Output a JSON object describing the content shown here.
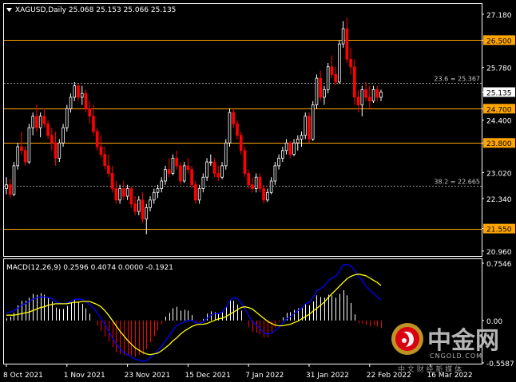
{
  "colors": {
    "background": "#000000",
    "frame": "#ffffff",
    "bull_candle": "#ffffff",
    "bear_candle": "#ff0000",
    "level_line": "#ffa500",
    "level_label_bg": "#ffa500",
    "fib_line": "#8c8c8c",
    "current_price_bg": "#ffffff",
    "macd_hist_pos": "#ffffff",
    "macd_hist_neg": "#ff0000",
    "macd_line": "#0000ff",
    "signal_line": "#ffff00",
    "watermark_red": "#e60012",
    "watermark_gold": "#c89b28"
  },
  "header": {
    "symbol_line": "XAGUSD,Daily  25.068 25.153 25.066 25.135",
    "arrow_icon": "triangle-down-icon"
  },
  "macd_header": "MACD(12,26,9) 0.2596 0.4074 0.0000 -0.1921",
  "current_price_label": "25.135",
  "fib_labels": [
    "23.6 = 25.367",
    "38.2 = 22.665"
  ],
  "watermark": {
    "cn": "中金网",
    "en": "CNGOLD.COM",
    "sub": "中 文 财 经 新 媒 体"
  },
  "chart_data": [
    {
      "type": "candlestick",
      "title": "XAGUSD,Daily",
      "ohlc_header": [
        25.068,
        25.153,
        25.066,
        25.135
      ],
      "ylim": [
        20.83,
        27.45
      ],
      "y_ticks": [
        "27.180",
        "26.500",
        "25.780",
        "25.135",
        "24.700",
        "24.400",
        "23.800",
        "23.020",
        "22.340",
        "21.550",
        "20.960"
      ],
      "x_tick_labels": [
        "8 Oct 2021",
        "1 Nov 2021",
        "23 Nov 2021",
        "15 Dec 2021",
        "7 Jan 2022",
        "31 Jan 2022",
        "22 Feb 2022",
        "16 Mar 2022"
      ],
      "x_tick_positions": [
        0,
        16,
        32,
        48,
        64,
        80,
        96,
        112
      ],
      "horizontal_levels": [
        26.5,
        24.7,
        23.8,
        21.55
      ],
      "fib_levels": [
        {
          "label": "23.6 = 25.367",
          "value": 25.367
        },
        {
          "label": "38.2 = 22.665",
          "value": 22.665
        }
      ],
      "current_price": 25.135,
      "ohlc": [
        [
          22.6,
          22.9,
          22.45,
          22.7
        ],
        [
          22.7,
          22.85,
          22.35,
          22.45
        ],
        [
          22.45,
          23.3,
          22.4,
          23.2
        ],
        [
          23.2,
          23.8,
          23.1,
          23.7
        ],
        [
          23.7,
          24.1,
          23.5,
          23.6
        ],
        [
          23.6,
          23.7,
          23.2,
          23.3
        ],
        [
          23.3,
          24.3,
          23.25,
          24.2
        ],
        [
          24.2,
          24.6,
          24.0,
          24.5
        ],
        [
          24.5,
          24.8,
          24.1,
          24.2
        ],
        [
          24.2,
          24.6,
          23.95,
          24.5
        ],
        [
          24.5,
          24.7,
          24.2,
          24.3
        ],
        [
          24.3,
          24.4,
          23.9,
          24.0
        ],
        [
          24.0,
          24.2,
          23.6,
          23.8
        ],
        [
          23.8,
          24.1,
          23.2,
          23.4
        ],
        [
          23.4,
          23.9,
          23.3,
          23.8
        ],
        [
          23.8,
          24.3,
          23.7,
          24.2
        ],
        [
          24.2,
          24.8,
          24.1,
          24.7
        ],
        [
          24.7,
          25.1,
          24.6,
          25.0
        ],
        [
          25.0,
          25.4,
          24.9,
          25.3
        ],
        [
          25.3,
          25.35,
          24.9,
          25.0
        ],
        [
          25.0,
          25.3,
          24.8,
          25.1
        ],
        [
          25.1,
          25.2,
          24.6,
          24.7
        ],
        [
          24.7,
          24.9,
          24.3,
          24.5
        ],
        [
          24.5,
          24.8,
          24.0,
          24.1
        ],
        [
          24.1,
          24.2,
          23.6,
          23.7
        ],
        [
          23.7,
          24.0,
          23.4,
          23.5
        ],
        [
          23.5,
          23.7,
          23.1,
          23.2
        ],
        [
          23.2,
          23.5,
          22.9,
          23.0
        ],
        [
          23.0,
          23.2,
          22.5,
          22.6
        ],
        [
          22.6,
          22.8,
          22.2,
          22.3
        ],
        [
          22.3,
          22.7,
          22.2,
          22.6
        ],
        [
          22.6,
          22.8,
          22.3,
          22.4
        ],
        [
          22.4,
          22.7,
          22.3,
          22.6
        ],
        [
          22.6,
          22.65,
          22.1,
          22.2
        ],
        [
          22.2,
          22.4,
          21.9,
          22.0
        ],
        [
          22.0,
          22.4,
          21.9,
          22.3
        ],
        [
          22.3,
          22.5,
          21.7,
          21.8
        ],
        [
          21.8,
          22.2,
          21.4,
          22.1
        ],
        [
          22.1,
          22.4,
          22.0,
          22.3
        ],
        [
          22.3,
          22.6,
          22.2,
          22.5
        ],
        [
          22.5,
          22.7,
          22.35,
          22.6
        ],
        [
          22.6,
          22.9,
          22.5,
          22.8
        ],
        [
          22.8,
          23.2,
          22.7,
          23.1
        ],
        [
          23.1,
          23.4,
          22.9,
          23.0
        ],
        [
          23.0,
          23.5,
          22.95,
          23.4
        ],
        [
          23.4,
          23.6,
          23.1,
          23.2
        ],
        [
          23.2,
          23.3,
          22.7,
          22.8
        ],
        [
          22.8,
          23.3,
          22.75,
          23.2
        ],
        [
          23.2,
          23.4,
          23.0,
          23.1
        ],
        [
          23.1,
          23.2,
          22.6,
          22.7
        ],
        [
          22.7,
          22.8,
          22.2,
          22.3
        ],
        [
          22.3,
          22.7,
          22.2,
          22.6
        ],
        [
          22.6,
          23.0,
          22.5,
          22.9
        ],
        [
          22.9,
          23.4,
          22.8,
          23.3
        ],
        [
          23.3,
          23.5,
          23.2,
          23.3
        ],
        [
          23.3,
          23.4,
          22.9,
          23.0
        ],
        [
          23.0,
          23.2,
          22.8,
          22.9
        ],
        [
          22.9,
          23.3,
          22.85,
          23.2
        ],
        [
          23.2,
          23.9,
          23.1,
          23.8
        ],
        [
          23.8,
          24.7,
          23.7,
          24.6
        ],
        [
          24.6,
          24.7,
          24.2,
          24.3
        ],
        [
          24.3,
          24.4,
          23.9,
          24.0
        ],
        [
          24.0,
          24.1,
          23.5,
          23.6
        ],
        [
          23.6,
          23.7,
          22.9,
          23.0
        ],
        [
          23.0,
          23.1,
          22.6,
          22.7
        ],
        [
          22.7,
          22.9,
          22.5,
          22.6
        ],
        [
          22.6,
          23.0,
          22.5,
          22.9
        ],
        [
          22.9,
          23.0,
          22.5,
          22.6
        ],
        [
          22.6,
          22.7,
          22.2,
          22.3
        ],
        [
          22.3,
          22.6,
          22.25,
          22.5
        ],
        [
          22.5,
          22.9,
          22.45,
          22.8
        ],
        [
          22.8,
          23.3,
          22.7,
          23.2
        ],
        [
          23.2,
          23.5,
          23.1,
          23.4
        ],
        [
          23.4,
          23.7,
          23.3,
          23.6
        ],
        [
          23.6,
          23.9,
          23.5,
          23.8
        ],
        [
          23.8,
          23.85,
          23.4,
          23.5
        ],
        [
          23.5,
          23.9,
          23.45,
          23.8
        ],
        [
          23.8,
          24.0,
          23.6,
          23.9
        ],
        [
          23.9,
          24.1,
          23.7,
          24.0
        ],
        [
          24.0,
          24.6,
          23.9,
          24.5
        ],
        [
          24.5,
          24.6,
          23.8,
          23.9
        ],
        [
          23.9,
          24.9,
          23.85,
          24.8
        ],
        [
          24.8,
          25.6,
          24.7,
          25.5
        ],
        [
          25.5,
          25.7,
          24.9,
          25.0
        ],
        [
          25.0,
          25.3,
          24.8,
          25.2
        ],
        [
          25.2,
          25.9,
          25.1,
          25.8
        ],
        [
          25.8,
          26.1,
          25.5,
          25.6
        ],
        [
          25.6,
          25.8,
          25.3,
          25.4
        ],
        [
          25.4,
          26.5,
          25.35,
          26.4
        ],
        [
          26.4,
          27.0,
          26.3,
          26.8
        ],
        [
          26.8,
          27.1,
          25.9,
          26.0
        ],
        [
          26.0,
          26.3,
          25.6,
          25.8
        ],
        [
          25.8,
          26.0,
          24.8,
          25.0
        ],
        [
          25.0,
          25.2,
          24.6,
          24.8
        ],
        [
          24.8,
          25.3,
          24.5,
          25.2
        ],
        [
          25.2,
          25.4,
          24.9,
          25.0
        ],
        [
          25.0,
          25.3,
          24.7,
          24.9
        ],
        [
          24.9,
          25.3,
          24.85,
          25.2
        ],
        [
          25.2,
          25.3,
          24.9,
          25.0
        ],
        [
          25.0,
          25.2,
          24.9,
          25.135
        ]
      ]
    },
    {
      "type": "line+bar",
      "title": "MACD(12,26,9)",
      "series_header": [
        0.2596,
        0.4074,
        0.0,
        -0.1921
      ],
      "ylim": [
        -0.5587,
        0.7546
      ],
      "y_ticks": [
        "0.7546",
        "0.00",
        "-0.5587"
      ],
      "histogram": [
        0.03,
        0.05,
        0.1,
        0.2,
        0.26,
        0.26,
        0.3,
        0.35,
        0.34,
        0.36,
        0.34,
        0.3,
        0.25,
        0.17,
        0.15,
        0.15,
        0.19,
        0.23,
        0.27,
        0.25,
        0.22,
        0.16,
        0.09,
        0.0,
        -0.07,
        -0.14,
        -0.21,
        -0.28,
        -0.35,
        -0.42,
        -0.44,
        -0.46,
        -0.45,
        -0.46,
        -0.48,
        -0.45,
        -0.45,
        -0.38,
        -0.29,
        -0.21,
        -0.13,
        -0.05,
        0.05,
        0.1,
        0.16,
        0.18,
        0.13,
        0.14,
        0.13,
        0.07,
        -0.02,
        -0.02,
        0.02,
        0.09,
        0.12,
        0.11,
        0.09,
        0.11,
        0.18,
        0.27,
        0.26,
        0.21,
        0.13,
        0.0,
        -0.09,
        -0.15,
        -0.16,
        -0.18,
        -0.23,
        -0.22,
        -0.17,
        -0.09,
        -0.02,
        0.04,
        0.1,
        0.11,
        0.14,
        0.16,
        0.17,
        0.22,
        0.2,
        0.25,
        0.33,
        0.31,
        0.3,
        0.34,
        0.33,
        0.3,
        0.35,
        0.4,
        0.33,
        0.23,
        0.08,
        -0.04,
        -0.04,
        -0.06,
        -0.08,
        -0.06,
        -0.08,
        -0.1
      ],
      "macd_line": [
        0.1,
        0.11,
        0.13,
        0.16,
        0.2,
        0.22,
        0.25,
        0.28,
        0.3,
        0.31,
        0.31,
        0.3,
        0.29,
        0.25,
        0.23,
        0.22,
        0.23,
        0.25,
        0.28,
        0.28,
        0.28,
        0.25,
        0.21,
        0.16,
        0.1,
        0.03,
        -0.05,
        -0.14,
        -0.23,
        -0.31,
        -0.37,
        -0.42,
        -0.45,
        -0.48,
        -0.51,
        -0.52,
        -0.54,
        -0.53,
        -0.49,
        -0.45,
        -0.4,
        -0.34,
        -0.27,
        -0.2,
        -0.13,
        -0.07,
        -0.04,
        -0.02,
        0.0,
        0.0,
        -0.03,
        -0.04,
        -0.02,
        0.03,
        0.07,
        0.09,
        0.09,
        0.11,
        0.17,
        0.26,
        0.3,
        0.29,
        0.24,
        0.16,
        0.06,
        -0.02,
        -0.06,
        -0.1,
        -0.16,
        -0.18,
        -0.17,
        -0.13,
        -0.09,
        -0.04,
        0.02,
        0.05,
        0.09,
        0.13,
        0.16,
        0.22,
        0.24,
        0.3,
        0.39,
        0.42,
        0.45,
        0.52,
        0.56,
        0.58,
        0.65,
        0.73,
        0.74,
        0.72,
        0.66,
        0.58,
        0.53,
        0.45,
        0.4,
        0.36,
        0.31,
        0.27
      ],
      "signal_line": [
        0.07,
        0.07,
        0.07,
        0.08,
        0.09,
        0.1,
        0.11,
        0.13,
        0.15,
        0.17,
        0.18,
        0.2,
        0.21,
        0.22,
        0.22,
        0.22,
        0.22,
        0.23,
        0.24,
        0.24,
        0.25,
        0.25,
        0.25,
        0.23,
        0.21,
        0.18,
        0.13,
        0.07,
        0.0,
        -0.07,
        -0.14,
        -0.2,
        -0.26,
        -0.31,
        -0.36,
        -0.39,
        -0.42,
        -0.44,
        -0.45,
        -0.44,
        -0.43,
        -0.4,
        -0.36,
        -0.32,
        -0.27,
        -0.23,
        -0.18,
        -0.14,
        -0.11,
        -0.08,
        -0.06,
        -0.05,
        -0.05,
        -0.04,
        -0.02,
        0.0,
        0.02,
        0.03,
        0.05,
        0.08,
        0.11,
        0.14,
        0.17,
        0.18,
        0.17,
        0.15,
        0.11,
        0.07,
        0.03,
        -0.01,
        -0.04,
        -0.06,
        -0.07,
        -0.07,
        -0.06,
        -0.05,
        -0.03,
        -0.01,
        0.02,
        0.05,
        0.08,
        0.12,
        0.16,
        0.2,
        0.24,
        0.3,
        0.35,
        0.4,
        0.45,
        0.5,
        0.55,
        0.58,
        0.6,
        0.61,
        0.6,
        0.59,
        0.56,
        0.53,
        0.5,
        0.46
      ]
    }
  ]
}
